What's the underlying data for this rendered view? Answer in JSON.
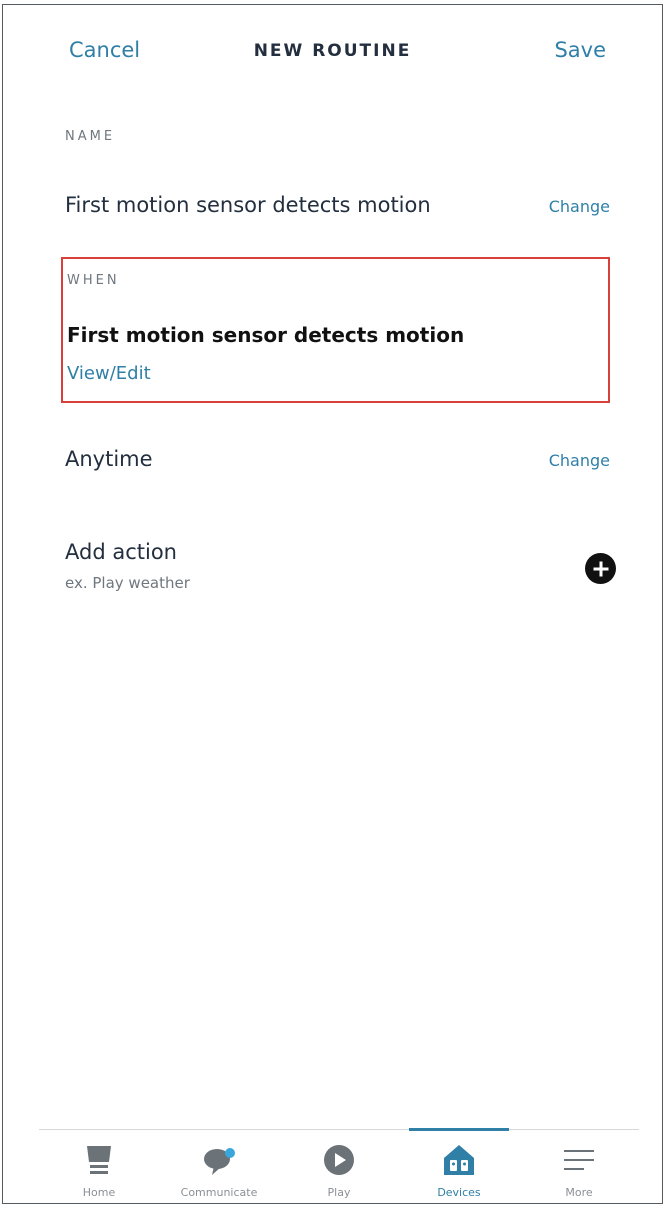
{
  "header": {
    "cancel_label": "Cancel",
    "title": "NEW ROUTINE",
    "save_label": "Save"
  },
  "name_section": {
    "label": "NAME",
    "value": "First motion sensor detects motion",
    "change_label": "Change"
  },
  "when_section": {
    "label": "WHEN",
    "value": "First motion sensor detects motion",
    "edit_label": "View/Edit"
  },
  "schedule": {
    "value": "Anytime",
    "change_label": "Change"
  },
  "action": {
    "title": "Add action",
    "subtitle": "ex. Play weather",
    "icon": "plus-circle-icon"
  },
  "nav": {
    "items": [
      {
        "label": "Home",
        "icon": "home-icon"
      },
      {
        "label": "Communicate",
        "icon": "chat-bubble-icon"
      },
      {
        "label": "Play",
        "icon": "play-icon"
      },
      {
        "label": "Devices",
        "icon": "devices-icon",
        "active": true
      },
      {
        "label": "More",
        "icon": "menu-icon"
      }
    ]
  },
  "colors": {
    "accent": "#2f7fa7",
    "highlight_border": "#d9403a",
    "text": "#232f3e",
    "muted": "#6f777e"
  }
}
